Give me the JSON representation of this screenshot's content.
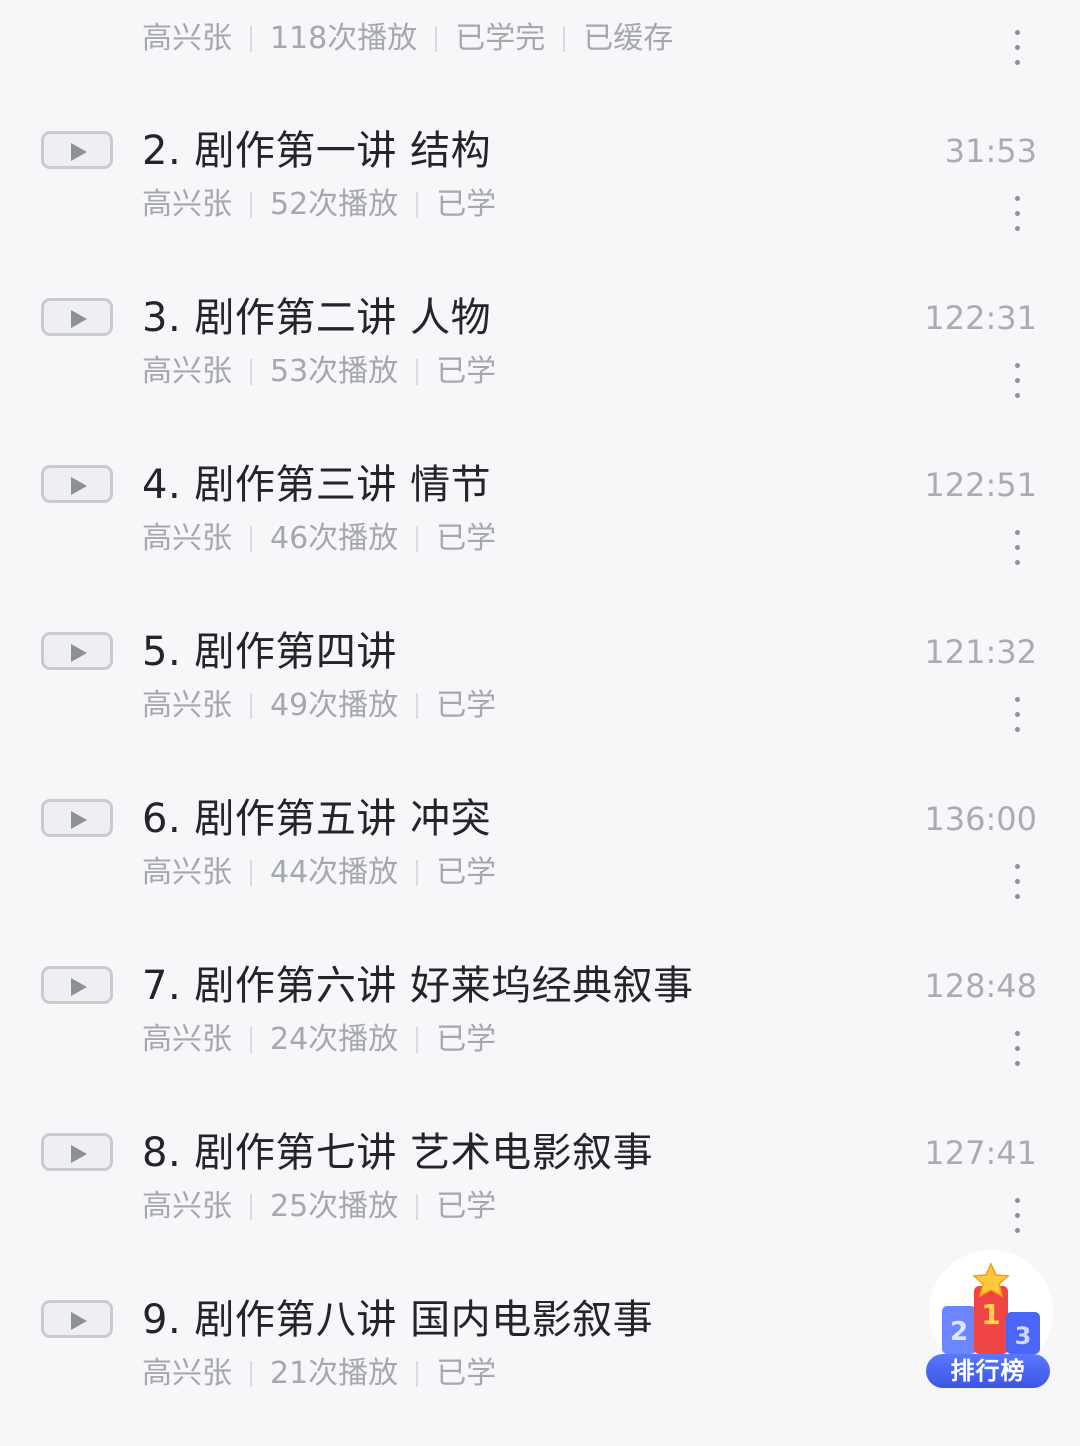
{
  "items": [
    {
      "title": "",
      "author": "高兴张",
      "plays": "118次播放",
      "status": "已学完",
      "cache": "已缓存",
      "duration": ""
    },
    {
      "title": "2. 剧作第一讲 结构",
      "author": "高兴张",
      "plays": "52次播放",
      "status": "已学",
      "cache": "",
      "duration": "31:53"
    },
    {
      "title": "3. 剧作第二讲 人物",
      "author": "高兴张",
      "plays": "53次播放",
      "status": "已学",
      "cache": "",
      "duration": "122:31"
    },
    {
      "title": "4. 剧作第三讲 情节",
      "author": "高兴张",
      "plays": "46次播放",
      "status": "已学",
      "cache": "",
      "duration": "122:51"
    },
    {
      "title": "5. 剧作第四讲",
      "author": "高兴张",
      "plays": "49次播放",
      "status": "已学",
      "cache": "",
      "duration": "121:32"
    },
    {
      "title": "6. 剧作第五讲 冲突",
      "author": "高兴张",
      "plays": "44次播放",
      "status": "已学",
      "cache": "",
      "duration": "136:00"
    },
    {
      "title": "7. 剧作第六讲 好莱坞经典叙事",
      "author": "高兴张",
      "plays": "24次播放",
      "status": "已学",
      "cache": "",
      "duration": "128:48"
    },
    {
      "title": "8. 剧作第七讲 艺术电影叙事",
      "author": "高兴张",
      "plays": "25次播放",
      "status": "已学",
      "cache": "",
      "duration": "127:41"
    },
    {
      "title": "9. 剧作第八讲 国内电影叙事",
      "author": "高兴张",
      "plays": "21次播放",
      "status": "已学",
      "cache": "",
      "duration": ""
    }
  ],
  "rank_badge": {
    "label": "排行榜",
    "digits": [
      "2",
      "1",
      "3"
    ]
  },
  "colors": {
    "background": "#f7f7f9",
    "title_text": "#23252b",
    "meta_text": "#a4a8b0",
    "badge_blue": "#4a66f5",
    "badge_red": "#f04545",
    "badge_star": "#ffc93a"
  },
  "icons": {
    "play": "play-icon",
    "more": "more-vertical-icon",
    "rank": "ranking-podium-icon"
  }
}
